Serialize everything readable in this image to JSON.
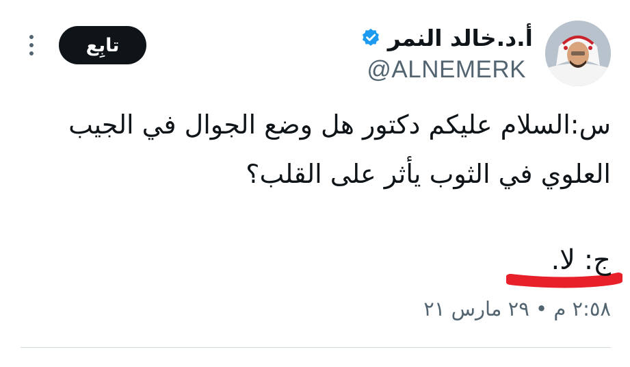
{
  "author": {
    "display_name": "أ.د.خالد النمر",
    "handle": "@ALNEMERK",
    "verified": true,
    "verified_icon": "verified-badge-icon"
  },
  "actions": {
    "follow_label": "تابِع",
    "more_icon": "more-vertical-icon"
  },
  "tweet": {
    "lines": [
      "س:السلام عليكم دكتور هل وضع الجوال في الجيب",
      "العلوي في الثوب يأثر على القلب؟"
    ],
    "answer": "ج: لا.",
    "timestamp": "٢:٥٨ م • ٢٩ مارس ٢١"
  },
  "colors": {
    "text": "#0f1419",
    "secondary": "#536471",
    "verified_blue": "#1d9bf0",
    "follow_bg": "#0f1419",
    "highlight_red": "#e8202a",
    "divider": "#cfd9de"
  }
}
